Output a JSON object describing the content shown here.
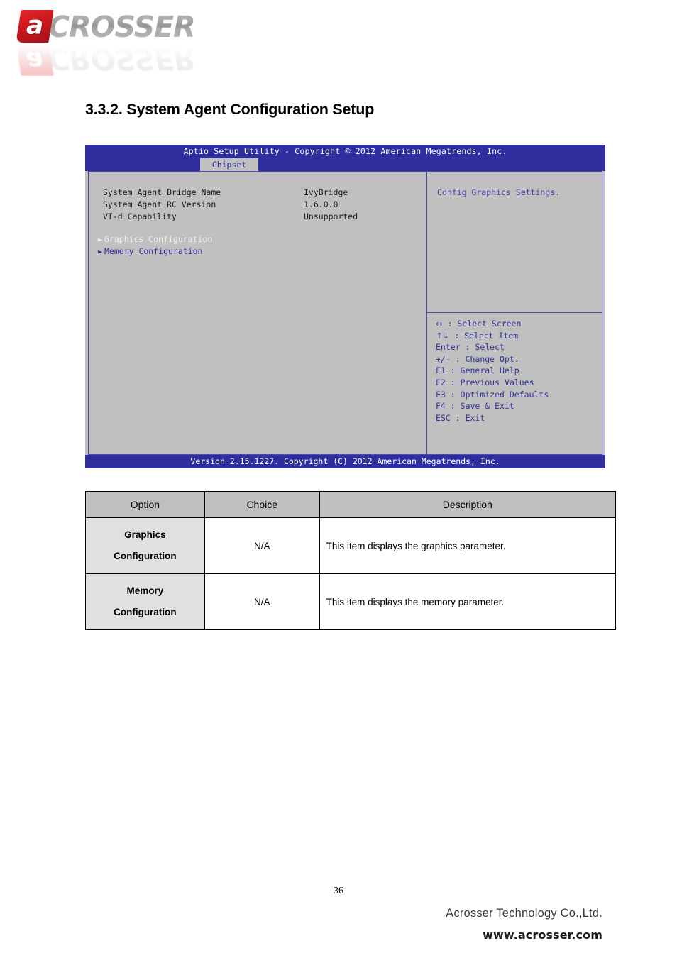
{
  "logo": {
    "mark_letter": "a",
    "wordmark": "CROSSER"
  },
  "heading": "3.3.2. System Agent Configuration Setup",
  "bios": {
    "title": "Aptio Setup Utility - Copyright © 2012 American Megatrends, Inc.",
    "tab": "Chipset",
    "info_rows": [
      {
        "label": "System Agent Bridge Name",
        "value": "IvyBridge"
      },
      {
        "label": "System Agent RC Version",
        "value": "1.6.0.0"
      },
      {
        "label": "VT-d Capability",
        "value": "Unsupported"
      }
    ],
    "menu_items": [
      {
        "label": "Graphics Configuration",
        "state": "selected"
      },
      {
        "label": "Memory Configuration",
        "state": "normal"
      }
    ],
    "help_text": "Config Graphics Settings.",
    "keys": [
      {
        "glyph": "↔",
        "text": ": Select Screen"
      },
      {
        "glyph": "↑↓",
        "text": ": Select Item"
      },
      {
        "glyph": "Enter",
        "text": ": Select"
      },
      {
        "glyph": "+/-",
        "text": ": Change Opt."
      },
      {
        "glyph": "F1",
        "text": ": General Help"
      },
      {
        "glyph": "F2",
        "text": ": Previous Values"
      },
      {
        "glyph": "F3",
        "text": ": Optimized Defaults"
      },
      {
        "glyph": "F4",
        "text": ": Save & Exit"
      },
      {
        "glyph": "ESC",
        "text": ": Exit"
      }
    ],
    "footer": "Version 2.15.1227. Copyright (C) 2012 American Megatrends, Inc.",
    "colors": {
      "title_bar": "#2e2e9e",
      "panel": "#c0c0c0",
      "border": "#4b4bb4",
      "link_text": "#2b2b9c"
    }
  },
  "table": {
    "headers": [
      "Option",
      "Choice",
      "Description"
    ],
    "rows": [
      {
        "option_line1": "Graphics",
        "option_line2": "Configuration",
        "choice": "N/A",
        "description": "This item displays the graphics parameter."
      },
      {
        "option_line1": "Memory",
        "option_line2": "Configuration",
        "choice": "N/A",
        "description": "This item displays the memory parameter."
      }
    ]
  },
  "footer": {
    "page_number": "36",
    "company": "Acrosser Technology Co.,Ltd.",
    "url": "www.acrosser.com"
  }
}
